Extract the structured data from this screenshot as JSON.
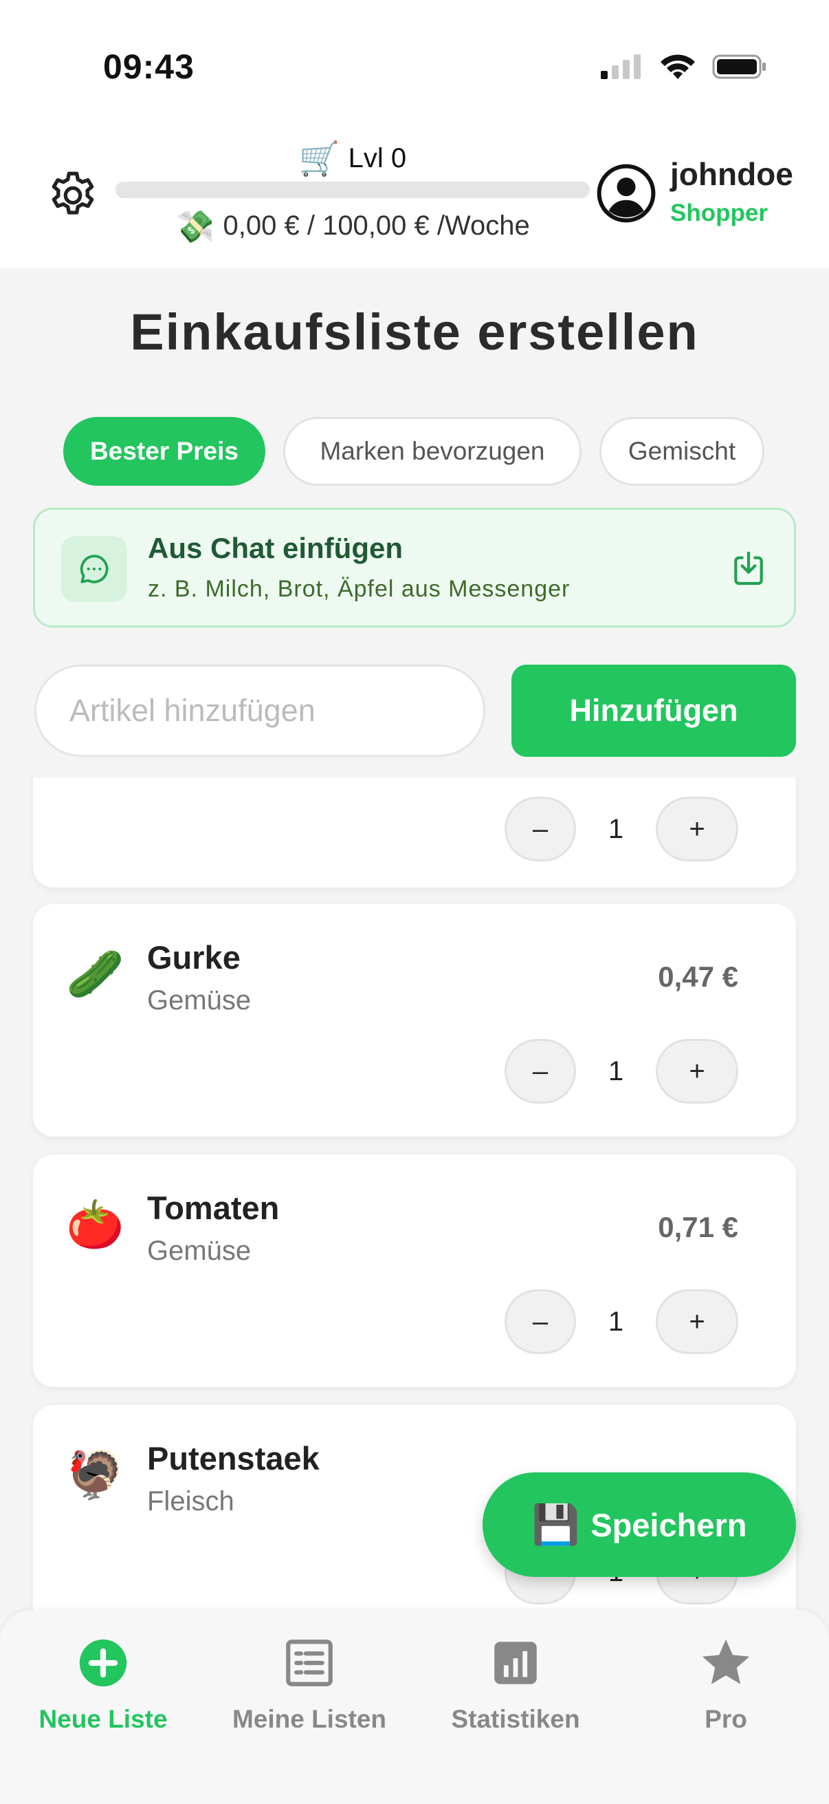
{
  "status_bar": {
    "time": "09:43"
  },
  "header": {
    "level_label": "Lvl 0",
    "xp_progress": 0,
    "budget_text": "0,00 € / 100,00 € /Woche",
    "username": "johndoe",
    "role": "Shopper"
  },
  "page": {
    "title": "Einkaufsliste erstellen"
  },
  "modes": {
    "items": [
      {
        "label": "Bester Preis",
        "active": true
      },
      {
        "label": "Marken bevorzugen",
        "active": false
      },
      {
        "label": "Gemischt",
        "active": false
      }
    ]
  },
  "chat_import": {
    "title": "Aus Chat einfügen",
    "subtitle": "z. B. Milch, Brot, Äpfel aus Messenger"
  },
  "add_item": {
    "placeholder": "Artikel hinzufügen",
    "button_label": "Hinzufügen"
  },
  "items": [
    {
      "name": "",
      "category": "",
      "price": "",
      "quantity": "1",
      "emoji": ""
    },
    {
      "name": "Gurke",
      "category": "Gemüse",
      "price": "0,47 €",
      "quantity": "1",
      "emoji": "🥒"
    },
    {
      "name": "Tomaten",
      "category": "Gemüse",
      "price": "0,71 €",
      "quantity": "1",
      "emoji": "🍅"
    },
    {
      "name": "Putenstaek",
      "category": "Fleisch",
      "price": "",
      "quantity": "1",
      "emoji": "🦃"
    }
  ],
  "qty_controls": {
    "minus": "–",
    "plus": "+"
  },
  "save_button": {
    "label": "Speichern",
    "icon": "💾"
  },
  "bottom_nav": {
    "items": [
      {
        "label": "Neue Liste",
        "icon": "plus-circle-icon",
        "active": true
      },
      {
        "label": "Meine Listen",
        "icon": "list-icon",
        "active": false
      },
      {
        "label": "Statistiken",
        "icon": "bar-chart-icon",
        "active": false
      },
      {
        "label": "Pro",
        "icon": "star-icon",
        "active": false
      }
    ]
  },
  "colors": {
    "accent": "#22c55e",
    "banner_bg": "#eefaf1",
    "banner_border": "#b7ebc7"
  }
}
